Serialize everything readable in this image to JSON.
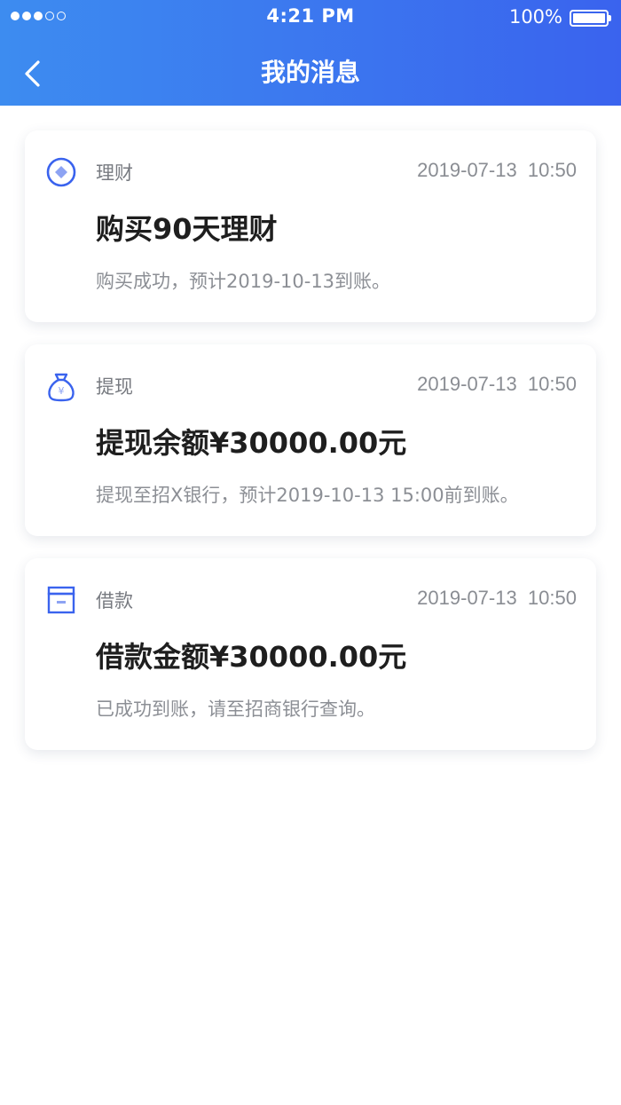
{
  "status_bar": {
    "time": "4:21 PM",
    "battery": "100%",
    "signal_bars_filled": 3,
    "signal_bars_total": 5
  },
  "nav": {
    "title": "我的消息",
    "back_icon": "chevron-left-icon"
  },
  "accent_color": "#3a63ee",
  "messages": [
    {
      "icon": "finance-coin-icon",
      "category": "理财",
      "datetime": "2019-07-13  10:50",
      "title": "购买90天理财",
      "description": "购买成功，预计2019-10-13到账。"
    },
    {
      "icon": "money-bag-icon",
      "category": "提现",
      "datetime": "2019-07-13  10:50",
      "title": "提现余额¥30000.00元",
      "description": "提现至招X银行，预计2019-10-13 15:00前到账。"
    },
    {
      "icon": "wallet-box-icon",
      "category": "借款",
      "datetime": "2019-07-13  10:50",
      "title": "借款金额¥30000.00元",
      "description": "已成功到账，请至招商银行查询。"
    }
  ]
}
